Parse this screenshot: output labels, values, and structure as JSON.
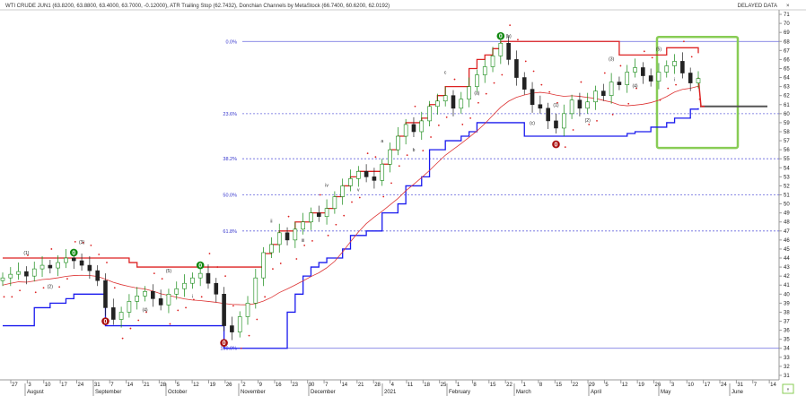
{
  "header": {
    "legend": "WTI CRUDE JUN1 (63.8200, 63.8800, 63.4000, 63.7000, -0.12000), ATR Trailing Stop (62.7432), Donchian Channels by MetaStock (66.7400, 60.6200, 62.0192)",
    "delayed": "DELAYED DATA",
    "close_icon": "close-x"
  },
  "colors": {
    "donchian_upper": "#dd2222",
    "donchian_lower": "#1a1aee",
    "atr_dots": "#dd2222",
    "ma": "#dd3333",
    "fib": "#6666dd",
    "up_candle": "#118811",
    "down_candle": "#222222",
    "box": "#88cc55",
    "zero_green": "#118811",
    "zero_red": "#aa1111"
  },
  "chart_data": {
    "type": "line",
    "title": "WTI CRUDE JUN1",
    "ylim": [
      30.5,
      71.5
    ],
    "y_ticks": [
      31,
      32,
      33,
      34,
      35,
      36,
      37,
      38,
      39,
      40,
      41,
      42,
      43,
      44,
      45,
      46,
      47,
      48,
      49,
      50,
      51,
      52,
      53,
      54,
      55,
      56,
      57,
      58,
      59,
      60,
      61,
      62,
      63,
      64,
      65,
      66,
      67,
      68,
      69,
      70,
      71
    ],
    "x_day_ticks": [
      "27",
      "3",
      "10",
      "17",
      "24",
      "31",
      "7",
      "14",
      "21",
      "28",
      "5",
      "12",
      "19",
      "26",
      "2",
      "9",
      "16",
      "23",
      "30",
      "7",
      "14",
      "21",
      "28",
      "4",
      "11",
      "18",
      "25",
      "1",
      "8",
      "15",
      "22",
      "1",
      "8",
      "15",
      "22",
      "29",
      "5",
      "12",
      "19",
      "26",
      "3",
      "10",
      "17",
      "24",
      "31",
      "7",
      "14"
    ],
    "months": [
      "August",
      "September",
      "October",
      "November",
      "December",
      "2021",
      "February",
      "March",
      "April",
      "May",
      "June"
    ],
    "fib_levels": [
      {
        "label": "0.0%",
        "value": 68.0
      },
      {
        "label": "23.6%",
        "value": 60.0
      },
      {
        "label": "38.2%",
        "value": 55.0
      },
      {
        "label": "50.0%",
        "value": 51.0
      },
      {
        "label": "61.8%",
        "value": 47.0
      },
      {
        "label": "100.0%",
        "value": 34.0
      }
    ],
    "zero_markers": [
      {
        "label": "0",
        "type": "top",
        "idx": 9,
        "value": 44.6
      },
      {
        "label": "0",
        "type": "bottom",
        "idx": 13,
        "value": 37.0
      },
      {
        "label": "0",
        "type": "top",
        "idx": 25,
        "value": 43.2
      },
      {
        "label": "0",
        "type": "bottom",
        "idx": 28,
        "value": 34.6
      },
      {
        "label": "0",
        "type": "top",
        "idx": 63,
        "value": 68.6
      },
      {
        "label": "0",
        "type": "bottom",
        "idx": 70,
        "value": 56.6
      }
    ],
    "wave_labels": [
      "(1)",
      "(2)",
      "(3)",
      "(4)",
      "(5)",
      "i",
      "ii",
      "iii",
      "iv",
      "v",
      "a",
      "b",
      "c",
      "(a)",
      "(b)",
      "(c)"
    ],
    "closes": [
      41.8,
      42.2,
      42.5,
      42.0,
      42.8,
      43.2,
      42.9,
      43.5,
      44.0,
      43.7,
      43.2,
      42.6,
      41.5,
      38.5,
      37.2,
      38.0,
      39.2,
      39.8,
      40.3,
      39.5,
      38.8,
      40.0,
      40.6,
      41.2,
      41.8,
      42.3,
      41.2,
      40.0,
      36.5,
      35.8,
      37.5,
      39.0,
      41.8,
      44.6,
      45.5,
      46.8,
      46.0,
      47.2,
      48.0,
      49.0,
      48.6,
      49.5,
      50.8,
      52.0,
      52.8,
      53.6,
      53.0,
      52.6,
      54.4,
      56.0,
      57.5,
      58.8,
      58.0,
      59.2,
      60.8,
      61.4,
      62.0,
      60.6,
      61.6,
      63.0,
      64.3,
      65.2,
      66.4,
      67.8,
      66.0,
      64.0,
      62.7,
      61.0,
      60.6,
      59.2,
      58.4,
      60.0,
      61.5,
      60.6,
      61.3,
      62.5,
      62.0,
      63.5,
      63.2,
      64.6,
      65.1,
      64.2,
      63.6,
      64.6,
      65.3,
      65.8,
      64.5,
      63.4,
      63.9
    ],
    "donchian_upper": [
      44,
      44,
      44,
      44,
      44,
      44,
      44,
      44,
      44,
      44,
      44,
      44,
      44,
      44,
      44,
      44,
      43.5,
      43,
      43,
      43,
      43,
      43,
      43,
      43,
      43,
      43,
      43,
      43,
      43,
      43,
      43,
      43,
      43,
      44.5,
      45.5,
      47,
      47,
      48,
      48,
      49,
      49,
      49.5,
      50.8,
      52,
      53,
      53.6,
      53.6,
      53.6,
      54.4,
      56,
      57.5,
      59,
      59,
      59.5,
      61,
      62,
      63,
      63,
      63,
      65,
      66,
      66.5,
      67.2,
      68,
      68,
      68,
      68,
      68,
      68,
      68,
      68,
      68,
      68,
      68,
      68,
      68,
      68,
      68,
      66.5,
      66.5,
      66.5,
      66.5,
      66.5,
      66.5,
      67.3,
      67.3,
      67.3,
      67.3,
      66.7
    ],
    "donchian_lower": [
      36.5,
      36.5,
      36.5,
      36.5,
      38.5,
      38.5,
      39,
      39,
      39.5,
      40,
      40,
      40,
      40,
      36.5,
      36.5,
      36.5,
      36.5,
      36.5,
      36.5,
      36.5,
      36.5,
      36.5,
      36.5,
      36.5,
      36.5,
      36.5,
      36.5,
      36.5,
      34,
      34,
      34,
      34,
      34,
      34,
      34,
      34,
      38,
      40,
      42,
      43,
      43.5,
      44,
      44,
      45,
      46.5,
      46.5,
      47,
      47,
      49,
      49,
      50,
      52,
      52,
      53,
      56,
      56,
      57,
      57,
      57.5,
      58,
      59,
      59,
      59,
      59,
      59,
      59,
      57.5,
      57.5,
      57.5,
      57.5,
      57.5,
      57.5,
      57.5,
      57.5,
      57.5,
      57.5,
      57.5,
      57.5,
      57.5,
      57.8,
      58,
      58,
      58.5,
      58.5,
      59,
      59.5,
      59.5,
      60.5,
      60.6
    ]
  }
}
